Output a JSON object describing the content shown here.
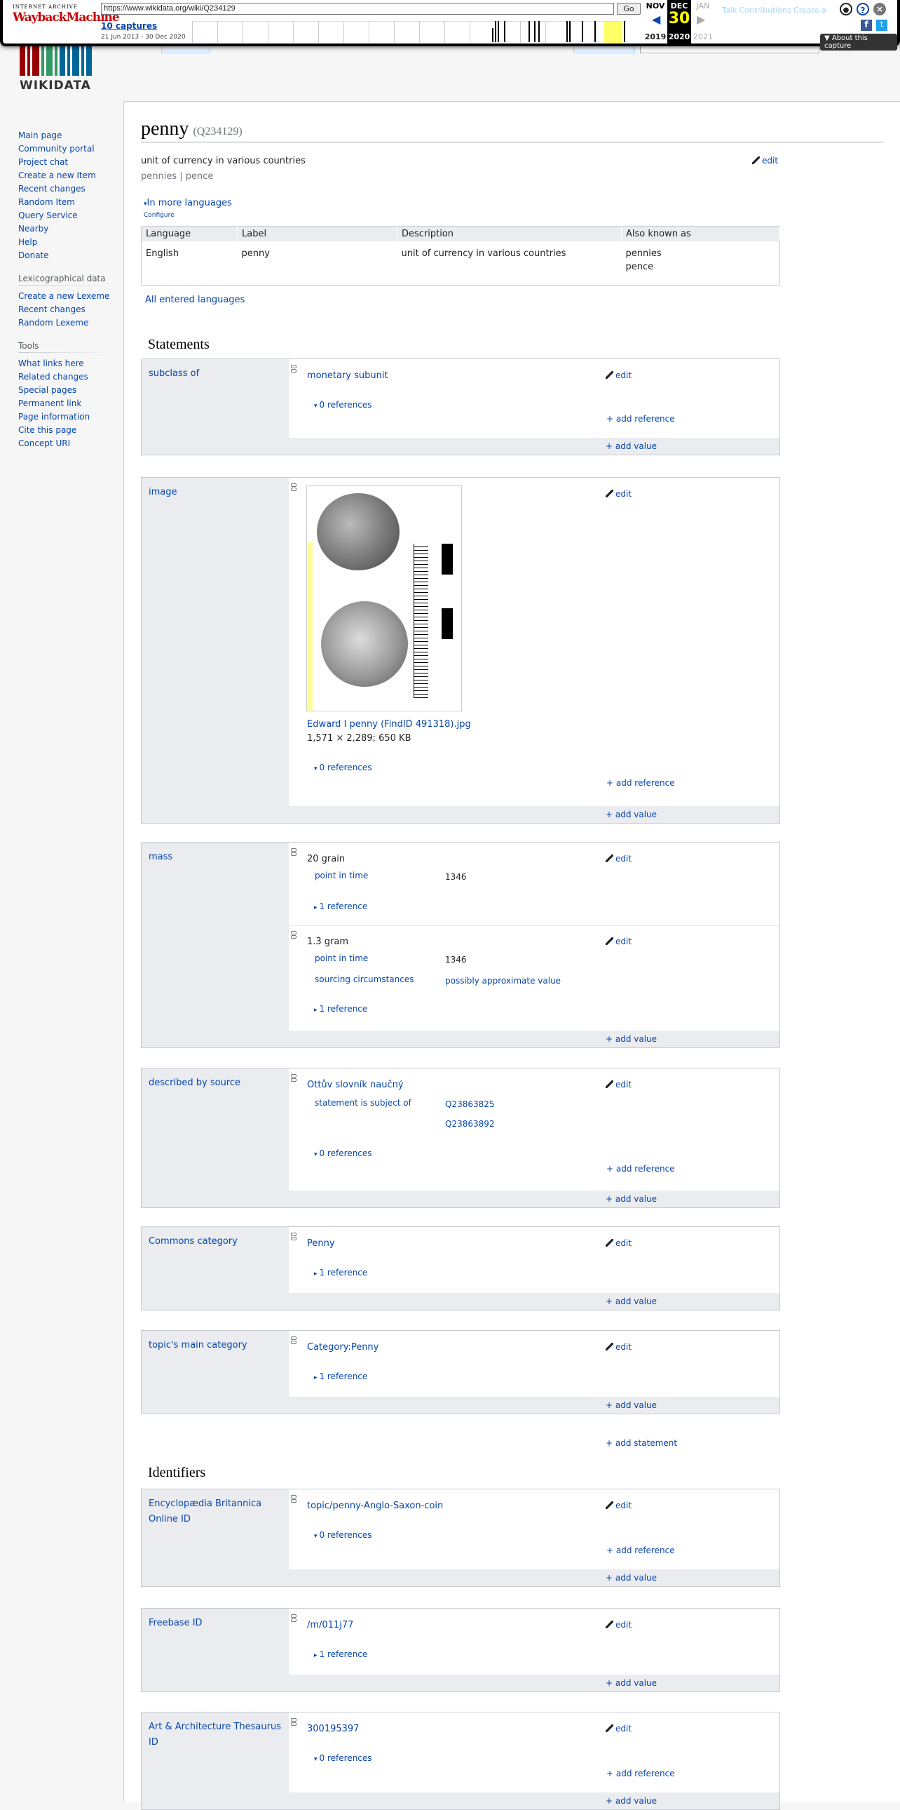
{
  "wayback": {
    "url": "https://www.wikidata.org/wiki/Q234129",
    "go": "Go",
    "captures": "10 captures",
    "range": "21 Jun 2013 - 30 Dec 2020",
    "ia": "INTERNET ARCHIVE",
    "wm": "WaybackMachine",
    "m_prev": "NOV",
    "m_cur": "DEC",
    "m_next": "JAN",
    "day": "30",
    "y_prev": "2019",
    "y_cur": "2020",
    "y_next": "2021",
    "about": "▼ About this capture",
    "ghost": "Talk Contributions Create a"
  },
  "logo": {
    "text": "WIKIDATA"
  },
  "sidebar": {
    "nav": [
      "Main page",
      "Community portal",
      "Project chat",
      "Create a new Item",
      "Recent changes",
      "Random Item",
      "Query Service",
      "Nearby",
      "Help",
      "Donate"
    ],
    "lex_title": "Lexicographical data",
    "lex": [
      "Create a new Lexeme",
      "Recent changes",
      "Random Lexeme"
    ],
    "tools_title": "Tools",
    "tools": [
      "What links here",
      "Related changes",
      "Special pages",
      "Permanent link",
      "Page information",
      "Cite this page",
      "Concept URI"
    ]
  },
  "page": {
    "title": "penny",
    "id": "(Q234129)",
    "description": "unit of currency in various countries",
    "aliases": "pennies | pence",
    "edit": "edit",
    "more_langs": "In more languages",
    "configure": "Configure",
    "all_langs": "All entered languages"
  },
  "terms": {
    "headers": [
      "Language",
      "Label",
      "Description",
      "Also known as"
    ],
    "row": {
      "lang": "English",
      "label": "penny",
      "desc": "unit of currency in various countries",
      "alias1": "pennies",
      "alias2": "pence"
    }
  },
  "sections": {
    "statements": "Statements",
    "identifiers": "Identifiers",
    "add_statement": "add statement"
  },
  "common": {
    "edit": "edit",
    "add_reference": "add reference",
    "add_value": "add value",
    "zero_refs": "0 references",
    "one_ref": "1 reference"
  },
  "statements": {
    "subclass": {
      "prop": "subclass of",
      "value": "monetary subunit"
    },
    "image": {
      "prop": "image",
      "file": "Edward I penny (FindID 491318).jpg",
      "meta": "1,571 × 2,289; 650 KB"
    },
    "mass": {
      "prop": "mass",
      "v1": "20 grain",
      "q1k": "point in time",
      "q1v": "1346",
      "v2": "1.3 gram",
      "q2k": "point in time",
      "q2v": "1346",
      "q3k": "sourcing circumstances",
      "q3v": "possibly approximate value"
    },
    "described": {
      "prop": "described by source",
      "value": "Ottův slovník naučný",
      "qk": "statement is subject of",
      "qv1": "Q23863825",
      "qv2": "Q23863892"
    },
    "commons": {
      "prop": "Commons category",
      "value": "Penny"
    },
    "topic": {
      "prop": "topic's main category",
      "value": "Category:Penny"
    },
    "britannica": {
      "prop": "Encyclopædia Britannica Online ID",
      "value": "topic/penny-Anglo-Saxon-coin"
    },
    "freebase": {
      "prop": "Freebase ID",
      "value": "/m/011j77"
    },
    "aat": {
      "prop": "Art & Architecture Thesaurus ID",
      "value": "300195397"
    }
  }
}
